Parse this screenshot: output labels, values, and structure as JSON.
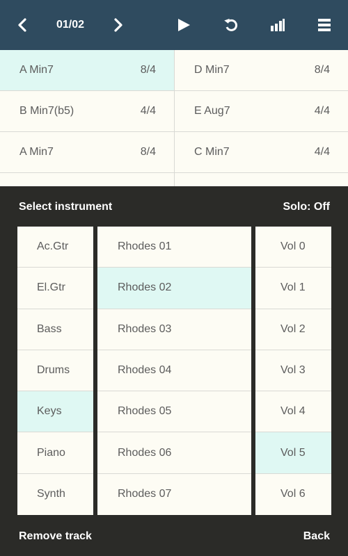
{
  "toolbar": {
    "prev_icon": "chevron-left-icon",
    "page": "01/02",
    "next_icon": "chevron-right-icon",
    "play_icon": "play-icon",
    "loop_icon": "loop-icon",
    "levels_icon": "bar-chart-icon",
    "menu_icon": "hamburger-menu-icon",
    "bg_color": "#2f4b5f"
  },
  "chords": [
    {
      "name": "A Min7",
      "time": "8/4",
      "selected": true
    },
    {
      "name": "D Min7",
      "time": "8/4",
      "selected": false
    },
    {
      "name": "B Min7(b5)",
      "time": "4/4",
      "selected": false
    },
    {
      "name": "E Aug7",
      "time": "4/4",
      "selected": false
    },
    {
      "name": "A Min7",
      "time": "8/4",
      "selected": false
    },
    {
      "name": "C Min7",
      "time": "4/4",
      "selected": false
    }
  ],
  "panel": {
    "title": "Select instrument",
    "solo_label": "Solo: Off"
  },
  "categories": [
    {
      "label": "Ac.Gtr",
      "selected": false
    },
    {
      "label": "El.Gtr",
      "selected": false
    },
    {
      "label": "Bass",
      "selected": false
    },
    {
      "label": "Drums",
      "selected": false
    },
    {
      "label": "Keys",
      "selected": true
    },
    {
      "label": "Piano",
      "selected": false
    },
    {
      "label": "Synth",
      "selected": false
    }
  ],
  "instruments": [
    {
      "label": "Rhodes 01",
      "selected": false
    },
    {
      "label": "Rhodes 02",
      "selected": true
    },
    {
      "label": "Rhodes 03",
      "selected": false
    },
    {
      "label": "Rhodes 04",
      "selected": false
    },
    {
      "label": "Rhodes 05",
      "selected": false
    },
    {
      "label": "Rhodes 06",
      "selected": false
    },
    {
      "label": "Rhodes 07",
      "selected": false
    }
  ],
  "volumes": [
    {
      "label": "Vol 0",
      "selected": false
    },
    {
      "label": "Vol 1",
      "selected": false
    },
    {
      "label": "Vol 2",
      "selected": false
    },
    {
      "label": "Vol 3",
      "selected": false
    },
    {
      "label": "Vol 4",
      "selected": false
    },
    {
      "label": "Vol 5",
      "selected": true
    },
    {
      "label": "Vol 6",
      "selected": false
    }
  ],
  "footer": {
    "remove_label": "Remove track",
    "back_label": "Back"
  },
  "colors": {
    "selected_bg": "#dff8f3",
    "panel_bg": "#2b2b28",
    "list_bg": "#fdfcf4"
  }
}
